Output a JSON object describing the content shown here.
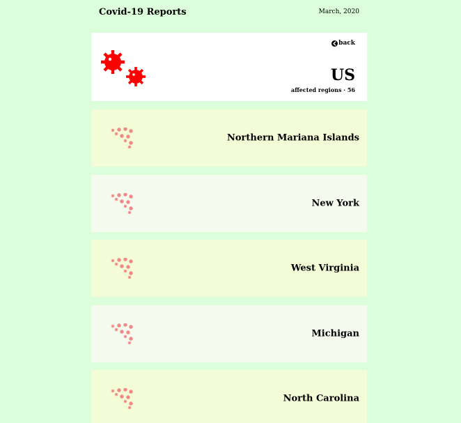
{
  "header": {
    "title": "Covid-19 Reports",
    "date": "March, 2020"
  },
  "country": {
    "back_label": "back",
    "name": "US",
    "regions_label": "affected regions",
    "regions_separator": " · ",
    "regions_count": "56"
  },
  "regions": [
    {
      "name": "Northern Mariana Islands"
    },
    {
      "name": "New York"
    },
    {
      "name": "West Virginia"
    },
    {
      "name": "Michigan"
    },
    {
      "name": "North Carolina"
    }
  ],
  "icons": {
    "logo": "virus-icon",
    "back": "arrow-left-circle-icon",
    "region": "virus-cluster-icon"
  },
  "colors": {
    "background": "#dcfedb",
    "virus": "#ff0000",
    "virus_faded": "#f08080",
    "card_odd": "#f3fcd6",
    "card_even": "#f4faee"
  }
}
